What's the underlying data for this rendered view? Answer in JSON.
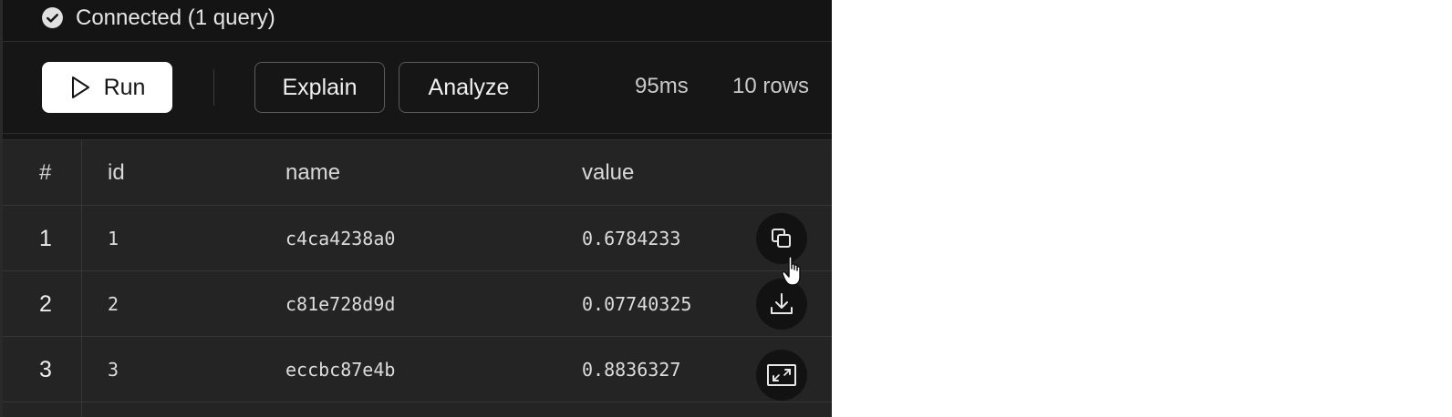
{
  "status": {
    "icon": "check-circle-icon",
    "text": "Connected (1 query)"
  },
  "toolbar": {
    "run_label": "Run",
    "explain_label": "Explain",
    "analyze_label": "Analyze",
    "time": "95ms",
    "rows": "10 rows"
  },
  "table": {
    "headers": [
      "#",
      "id",
      "name",
      "value"
    ],
    "rows": [
      {
        "num": "1",
        "id": "1",
        "name": "c4ca4238a0",
        "value": "0.6784233"
      },
      {
        "num": "2",
        "id": "2",
        "name": "c81e728d9d",
        "value": "0.07740325"
      },
      {
        "num": "3",
        "id": "3",
        "name": "eccbc87e4b",
        "value": "0.8836327"
      }
    ]
  },
  "actions": [
    "copy-icon",
    "download-icon",
    "expand-icon"
  ],
  "colors": {
    "panel_bg": "#161616",
    "grid_bg": "#242424",
    "run_bg": "#ffffff",
    "text": "#e6e6e6"
  }
}
